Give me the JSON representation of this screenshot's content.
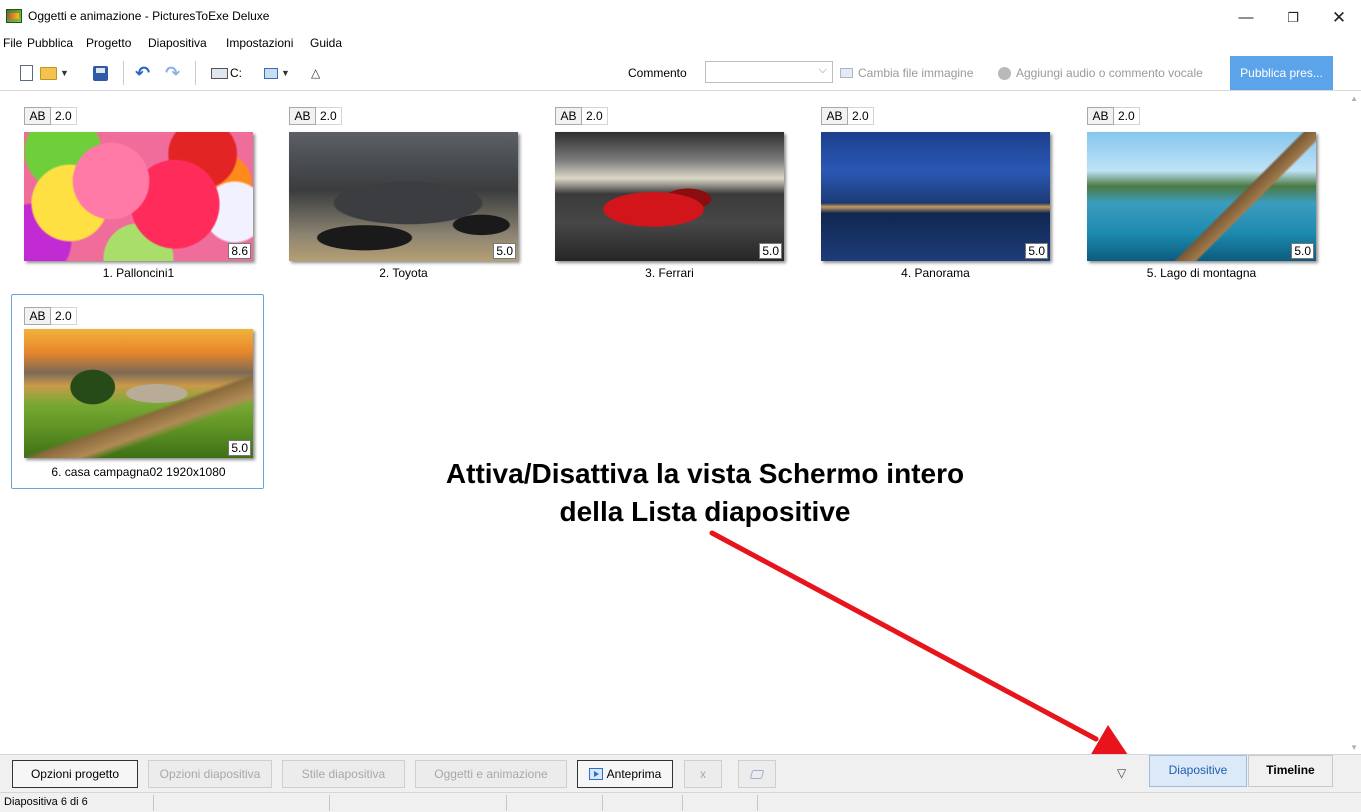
{
  "window": {
    "title": "Oggetti e animazione - PicturesToExe Deluxe",
    "controls": {
      "minimize": "—",
      "maximize": "❐",
      "close": "✕"
    }
  },
  "menu": [
    "File",
    "Pubblica",
    "Progetto",
    "Diapositiva",
    "Impostazioni",
    "Guida"
  ],
  "toolbar": {
    "drive": "C:",
    "comment_label": "Commento",
    "comment_value": "",
    "change_image": "Cambia file immagine",
    "add_audio": "Aggiungi audio o commento vocale",
    "publish": "Pubblica pres..."
  },
  "slides": [
    {
      "ab": "AB",
      "transition": "2.0",
      "duration": "8.6",
      "caption": "1. Palloncini1"
    },
    {
      "ab": "AB",
      "transition": "2.0",
      "duration": "5.0",
      "caption": "2. Toyota"
    },
    {
      "ab": "AB",
      "transition": "2.0",
      "duration": "5.0",
      "caption": "3. Ferrari"
    },
    {
      "ab": "AB",
      "transition": "2.0",
      "duration": "5.0",
      "caption": "4. Panorama"
    },
    {
      "ab": "AB",
      "transition": "2.0",
      "duration": "5.0",
      "caption": "5. Lago di  montagna"
    },
    {
      "ab": "AB",
      "transition": "2.0",
      "duration": "5.0",
      "caption": "6. casa campagna02 1920x1080"
    }
  ],
  "annotation": {
    "line1": "Attiva/Disattiva la vista Schermo intero",
    "line2": "della Lista diapositive",
    "arrow_color": "#e8141b"
  },
  "bottom": {
    "project_options": "Opzioni progetto",
    "slide_options": "Opzioni diapositiva",
    "slide_style": "Stile diapositiva",
    "objects_animation": "Oggetti e animazione",
    "preview": "Anteprima",
    "x": "x",
    "toggle": "▽",
    "tab_slides": "Diapositive",
    "tab_timeline": "Timeline"
  },
  "status": {
    "text": "Diapositiva 6 di 6"
  },
  "colors": {
    "accent": "#5ca4ea",
    "selection_border": "#6aa3dc",
    "tab_active_bg": "#dbe9f8"
  }
}
